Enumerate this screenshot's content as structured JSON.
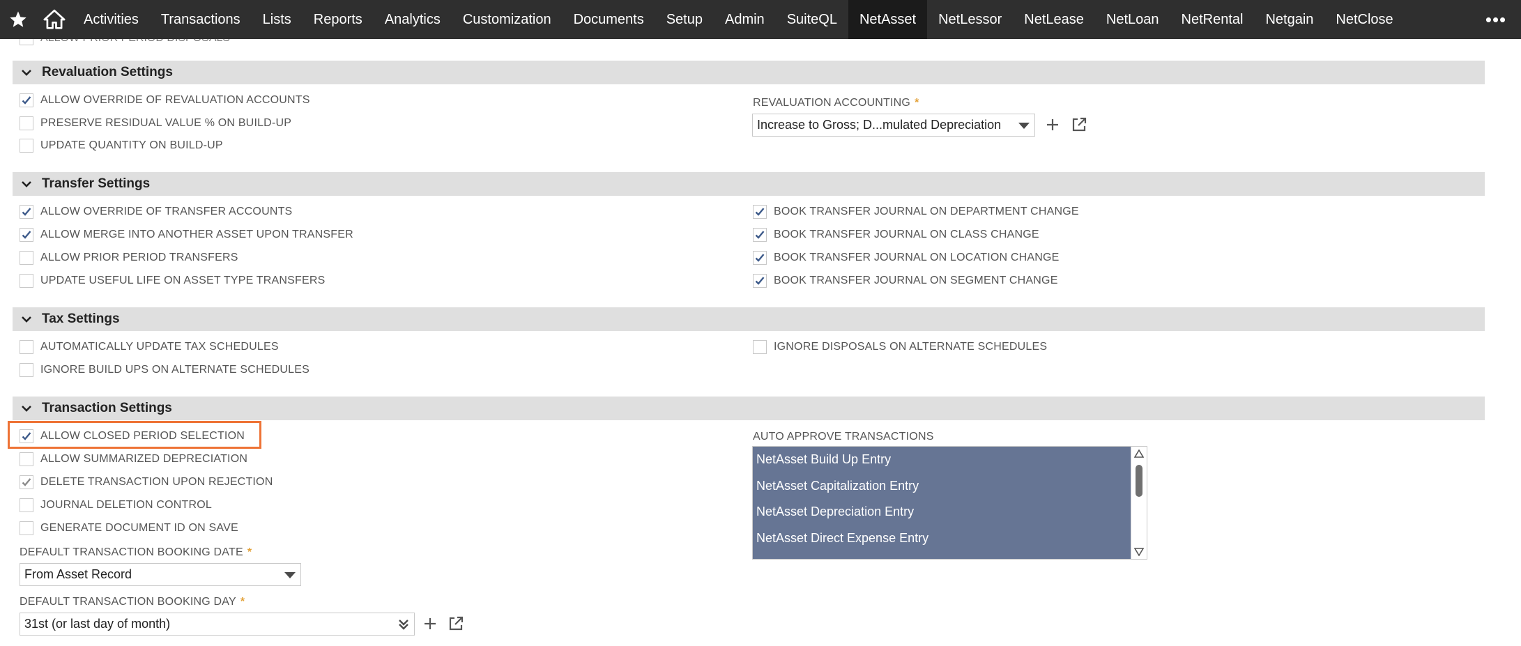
{
  "nav": {
    "items": [
      {
        "label": "Activities"
      },
      {
        "label": "Transactions"
      },
      {
        "label": "Lists"
      },
      {
        "label": "Reports"
      },
      {
        "label": "Analytics"
      },
      {
        "label": "Customization"
      },
      {
        "label": "Documents"
      },
      {
        "label": "Setup"
      },
      {
        "label": "Admin"
      },
      {
        "label": "SuiteQL"
      },
      {
        "label": "NetAsset"
      },
      {
        "label": "NetLessor"
      },
      {
        "label": "NetLease"
      },
      {
        "label": "NetLoan"
      },
      {
        "label": "NetRental"
      },
      {
        "label": "Netgain"
      },
      {
        "label": "NetClose"
      }
    ],
    "active": "NetAsset",
    "more": "•••"
  },
  "cut_row_label": "ALLOW PRIOR PERIOD DISPOSALS",
  "revaluation": {
    "title": "Revaluation Settings",
    "checkboxes": [
      {
        "label": "ALLOW OVERRIDE OF REVALUATION ACCOUNTS",
        "checked": true
      },
      {
        "label": "PRESERVE RESIDUAL VALUE % ON BUILD-UP",
        "checked": false
      },
      {
        "label": "UPDATE QUANTITY ON BUILD-UP",
        "checked": false
      }
    ],
    "accounting_label": "REVALUATION ACCOUNTING",
    "accounting_required": "*",
    "accounting_value": "Increase to Gross; D...mulated Depreciation"
  },
  "transfer": {
    "title": "Transfer Settings",
    "left": [
      {
        "label": "ALLOW OVERRIDE OF TRANSFER ACCOUNTS",
        "checked": true
      },
      {
        "label": "ALLOW MERGE INTO ANOTHER ASSET UPON TRANSFER",
        "checked": true
      },
      {
        "label": "ALLOW PRIOR PERIOD TRANSFERS",
        "checked": false
      },
      {
        "label": "UPDATE USEFUL LIFE ON ASSET TYPE TRANSFERS",
        "checked": false
      }
    ],
    "right": [
      {
        "label": "BOOK TRANSFER JOURNAL ON DEPARTMENT CHANGE",
        "checked": true
      },
      {
        "label": "BOOK TRANSFER JOURNAL ON CLASS CHANGE",
        "checked": true
      },
      {
        "label": "BOOK TRANSFER JOURNAL ON LOCATION CHANGE",
        "checked": true
      },
      {
        "label": "BOOK TRANSFER JOURNAL ON SEGMENT CHANGE",
        "checked": true
      }
    ]
  },
  "tax": {
    "title": "Tax Settings",
    "left": [
      {
        "label": "AUTOMATICALLY UPDATE TAX SCHEDULES",
        "checked": false
      },
      {
        "label": "IGNORE BUILD UPS ON ALTERNATE SCHEDULES",
        "checked": false
      }
    ],
    "right": [
      {
        "label": "IGNORE DISPOSALS ON ALTERNATE SCHEDULES",
        "checked": false
      }
    ]
  },
  "transaction": {
    "title": "Transaction Settings",
    "left": [
      {
        "label": "ALLOW CLOSED PERIOD SELECTION",
        "checked": true
      },
      {
        "label": "ALLOW SUMMARIZED DEPRECIATION",
        "checked": false
      },
      {
        "label": "DELETE TRANSACTION UPON REJECTION",
        "checked": true
      },
      {
        "label": "JOURNAL DELETION CONTROL",
        "checked": false
      },
      {
        "label": "GENERATE DOCUMENT ID ON SAVE",
        "checked": false
      }
    ],
    "booking_date_label": "DEFAULT TRANSACTION BOOKING DATE",
    "booking_date_value": "From Asset Record",
    "booking_day_label": "DEFAULT TRANSACTION BOOKING DAY",
    "booking_day_value": "31st (or last day of month)",
    "required": "*",
    "auto_approve_label": "AUTO APPROVE TRANSACTIONS",
    "auto_approve_options": [
      "NetAsset Build Up Entry",
      "NetAsset Capitalization Entry",
      "NetAsset Depreciation Entry",
      "NetAsset Direct Expense Entry"
    ]
  },
  "colors": {
    "nav_bg": "#2f2f2f",
    "section_bg": "#dfdfdf",
    "highlight": "#ee7336",
    "multiselect_bg": "#667594",
    "check": "#3d5a8a",
    "required": "#e3a23a"
  }
}
